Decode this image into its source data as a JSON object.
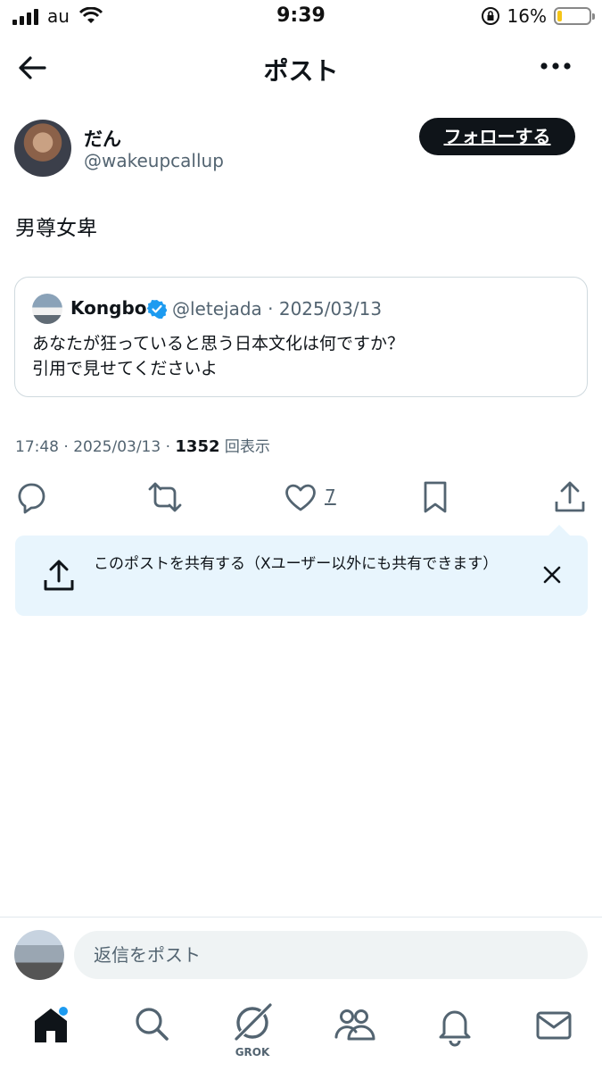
{
  "status_bar": {
    "carrier": "au",
    "time": "9:39",
    "battery_percent": "16%",
    "battery_level": 0.16
  },
  "header": {
    "title": "ポスト"
  },
  "post": {
    "author_name": "だん",
    "author_handle": "@wakeupcallup",
    "follow_label": "フォローする",
    "text": "男尊女卑",
    "timestamp": "17:48 · 2025/03/13 · ",
    "views_count": "1352",
    "views_label": " 回表示",
    "like_count": "7"
  },
  "quote": {
    "name": "Kongbo",
    "handle_date": "@letejada · 2025/03/13",
    "text_line1": "あなたが狂っていると思う日本文化は何ですか？",
    "text_line2": "引用で見せてくださいよ"
  },
  "share_banner": {
    "text": "このポストを共有する（Xユーザー以外にも共有できます）"
  },
  "reply": {
    "placeholder": "返信をポスト"
  },
  "tabbar": {
    "grok_label": "GROK"
  },
  "colors": {
    "accent": "#1d9bf0",
    "text_secondary": "#536471",
    "banner_bg": "#e8f5fd"
  }
}
